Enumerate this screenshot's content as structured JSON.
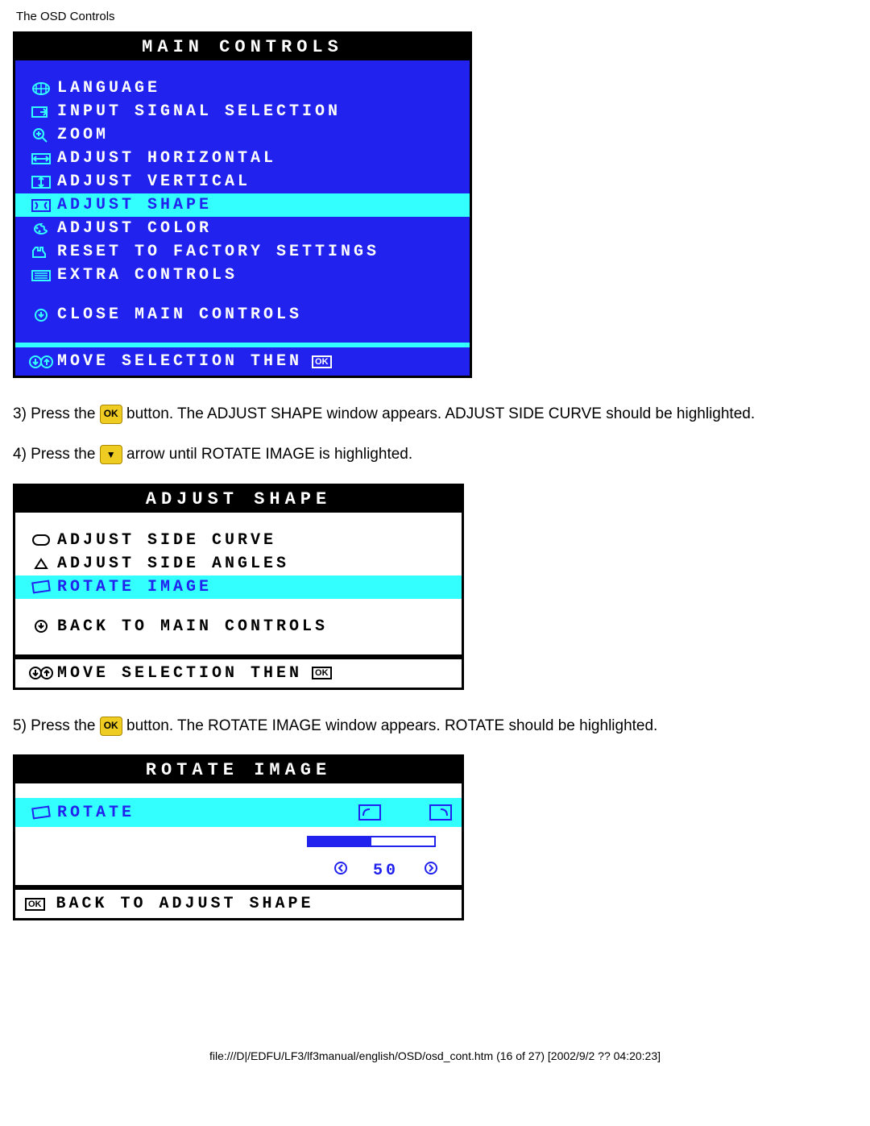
{
  "page_header": "The OSD Controls",
  "main_controls": {
    "title": "MAIN CONTROLS",
    "items": [
      {
        "label": "LANGUAGE",
        "highlighted": false
      },
      {
        "label": "INPUT SIGNAL SELECTION",
        "highlighted": false
      },
      {
        "label": "ZOOM",
        "highlighted": false
      },
      {
        "label": "ADJUST HORIZONTAL",
        "highlighted": false
      },
      {
        "label": "ADJUST VERTICAL",
        "highlighted": false
      },
      {
        "label": "ADJUST SHAPE",
        "highlighted": true
      },
      {
        "label": "ADJUST COLOR",
        "highlighted": false
      },
      {
        "label": "RESET TO FACTORY SETTINGS",
        "highlighted": false
      },
      {
        "label": "EXTRA CONTROLS",
        "highlighted": false
      }
    ],
    "close_label": "CLOSE MAIN CONTROLS",
    "footer_hint": "MOVE SELECTION THEN",
    "footer_ok": "OK"
  },
  "instruction3a": "3) Press the ",
  "instruction3b": " button. The ADJUST SHAPE window appears. ADJUST SIDE CURVE should be highlighted.",
  "instruction4a": "4) Press the ",
  "instruction4b": " arrow until ROTATE IMAGE is highlighted.",
  "adjust_shape": {
    "title": "ADJUST SHAPE",
    "items": [
      {
        "label": "ADJUST SIDE CURVE",
        "highlighted": false
      },
      {
        "label": "ADJUST SIDE ANGLES",
        "highlighted": false
      },
      {
        "label": "ROTATE IMAGE",
        "highlighted": true
      }
    ],
    "back_label": "BACK TO MAIN CONTROLS",
    "footer_hint": "MOVE SELECTION THEN",
    "footer_ok": "OK"
  },
  "instruction5a": "5) Press the ",
  "instruction5b": " button. The ROTATE IMAGE window appears. ROTATE should be highlighted.",
  "rotate_image": {
    "title": "ROTATE IMAGE",
    "item_label": "ROTATE",
    "value": "50",
    "back_label": "BACK TO ADJUST SHAPE",
    "back_ok": "OK"
  },
  "footer_path": "file:///D|/EDFU/LF3/lf3manual/english/OSD/osd_cont.htm (16 of 27) [2002/9/2 ?? 04:20:23]"
}
